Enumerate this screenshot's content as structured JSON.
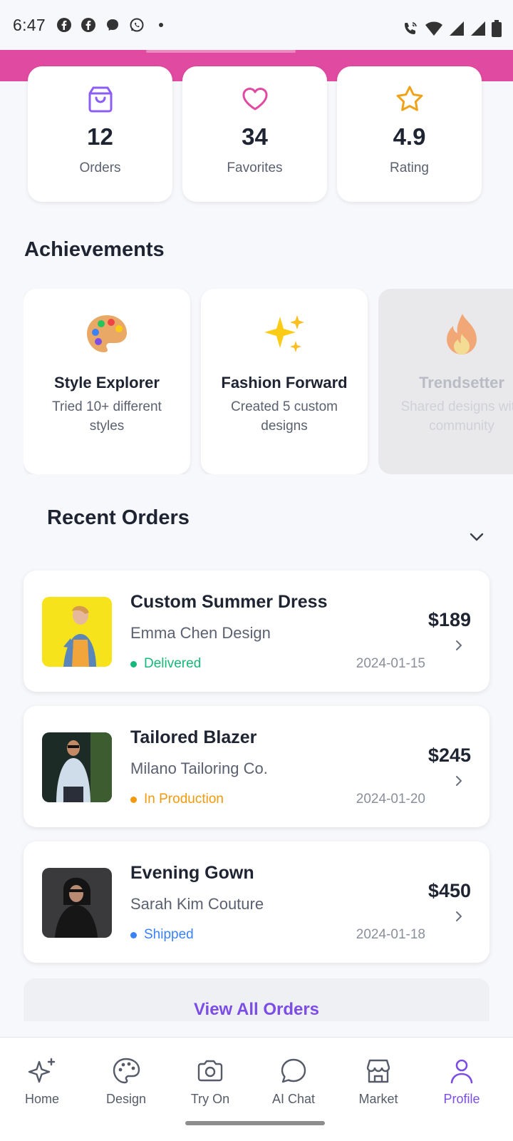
{
  "status_bar": {
    "time": "6:47"
  },
  "stats": [
    {
      "icon": "shopping-bag-icon",
      "value": "12",
      "label": "Orders",
      "color": "#8b5cf6"
    },
    {
      "icon": "heart-icon",
      "value": "34",
      "label": "Favorites",
      "color": "#e04aa0"
    },
    {
      "icon": "star-icon",
      "value": "4.9",
      "label": "Rating",
      "color": "#f0a21a"
    }
  ],
  "achievements": {
    "title": "Achievements",
    "items": [
      {
        "emoji": "palette",
        "title": "Style Explorer",
        "desc": "Tried 10+ different styles",
        "locked": false
      },
      {
        "emoji": "sparkles",
        "title": "Fashion Forward",
        "desc": "Created 5 custom designs",
        "locked": false
      },
      {
        "emoji": "fire",
        "title": "Trendsetter",
        "desc": "Shared designs with community",
        "locked": true
      }
    ]
  },
  "recent_orders": {
    "title": "Recent Orders",
    "items": [
      {
        "name": "Custom Summer Dress",
        "shop": "Emma Chen Design",
        "status": "Delivered",
        "status_color": "#16b97a",
        "date": "2024-01-15",
        "price": "$189"
      },
      {
        "name": "Tailored Blazer",
        "shop": "Milano Tailoring Co.",
        "status": "In Production",
        "status_color": "#f29a0e",
        "date": "2024-01-20",
        "price": "$245"
      },
      {
        "name": "Evening Gown",
        "shop": "Sarah Kim Couture",
        "status": "Shipped",
        "status_color": "#3b82f6",
        "date": "2024-01-18",
        "price": "$450"
      }
    ],
    "view_all": "View All Orders"
  },
  "bottom_nav": [
    {
      "label": "Home",
      "icon": "sparkles-icon",
      "active": false
    },
    {
      "label": "Design",
      "icon": "palette-icon",
      "active": false
    },
    {
      "label": "Try On",
      "icon": "camera-icon",
      "active": false
    },
    {
      "label": "AI Chat",
      "icon": "chat-bubble-icon",
      "active": false
    },
    {
      "label": "Market",
      "icon": "store-icon",
      "active": false
    },
    {
      "label": "Profile",
      "icon": "person-icon",
      "active": true
    }
  ],
  "accent_color": "#7b4de6",
  "header_color": "#e04aa0"
}
